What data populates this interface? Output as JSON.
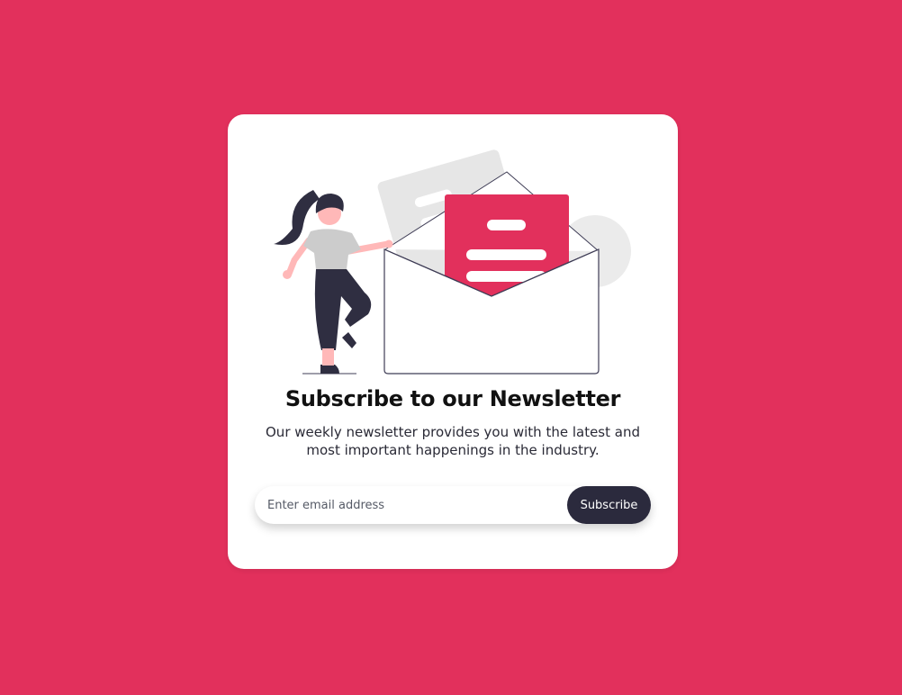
{
  "colors": {
    "background": "#e2305c",
    "card": "#ffffff",
    "accent": "#e2305c",
    "button": "#2b2a3d",
    "button_text": "#ffffff",
    "illustration_gray": "#e6e6e6",
    "figure_dark": "#2f2e41",
    "skin": "#ffb8b8"
  },
  "newsletter": {
    "title": "Subscribe to our Newsletter",
    "description": "Our weekly newsletter provides you with the latest and most important happenings in the industry.",
    "email_placeholder": "Enter email address",
    "email_value": "",
    "subscribe_label": "Subscribe"
  },
  "icons": {
    "illustration": "woman-with-envelope-illustration"
  }
}
